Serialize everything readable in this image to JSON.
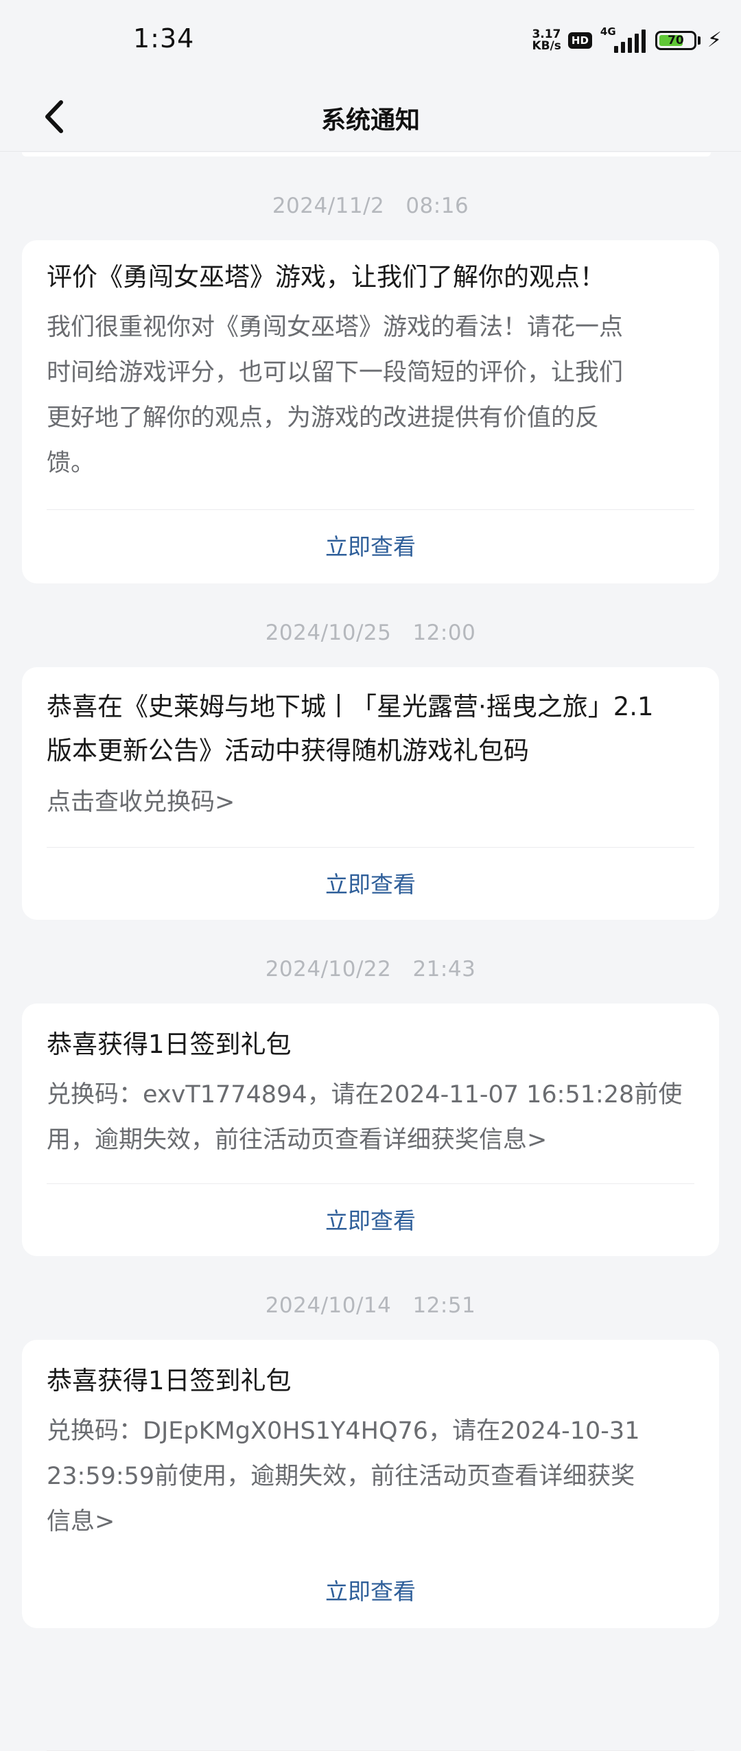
{
  "status_bar": {
    "time": "1:34",
    "net_speed_value": "3.17",
    "net_speed_unit": "KB/s",
    "hd_label": "HD",
    "network_label": "4G",
    "battery_level": "70",
    "battery_fraction": 0.7,
    "battery_color": "#5fc736"
  },
  "header": {
    "title": "系统通知",
    "back_icon": "chevron-left-icon"
  },
  "colors": {
    "background": "#f4f5f7",
    "card": "#ffffff",
    "link": "#2f5f9a",
    "timestamp": "#b5b8bd",
    "body_text": "#6a6c70"
  },
  "notices": [
    {
      "date": "2024/11/2",
      "time": "08:16",
      "title": "评价《勇闯女巫塔》游戏，让我们了解你的观点！",
      "body_lines": [
        "我们很重视你对《勇闯女巫塔》游戏的看法！请花一点",
        "时间给游戏评分，也可以留下一段简短的评价，让我们",
        "更好地了解你的观点，为游戏的改进提供有价值的反",
        "馈。"
      ],
      "action": "立即查看"
    },
    {
      "date": "2024/10/25",
      "time": "12:00",
      "title_lines": [
        "恭喜在《史莱姆与地下城丨「星光露营·摇曳之旅」2.1",
        "版本更新公告》活动中获得随机游戏礼包码"
      ],
      "body_lines": [
        "点击查收兑换码>"
      ],
      "action": "立即查看"
    },
    {
      "date": "2024/10/22",
      "time": "21:43",
      "title": "恭喜获得1日签到礼包",
      "body_lines": [
        "兑换码：exvT1774894，请在2024-11-07 16:51:28前使",
        "用，逾期失效，前往活动页查看详细获奖信息>"
      ],
      "action": "立即查看"
    },
    {
      "date": "2024/10/14",
      "time": "12:51",
      "title": "恭喜获得1日签到礼包",
      "body_lines": [
        "兑换码：DJEpKMgX0HS1Y4HQ76，请在2024-10-31",
        "23:59:59前使用，逾期失效，前往活动页查看详细获奖",
        "信息>"
      ],
      "action": "立即查看"
    }
  ]
}
